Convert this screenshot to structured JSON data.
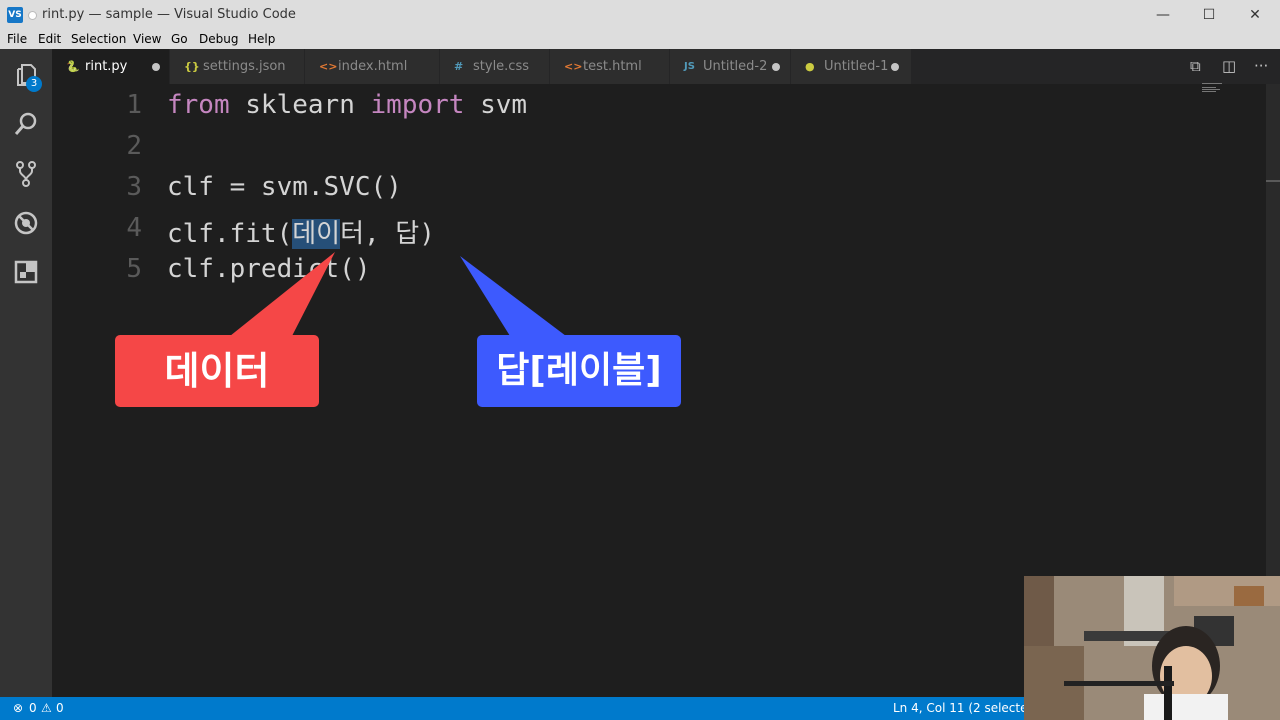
{
  "window": {
    "title": "rint.py — sample — Visual Studio Code",
    "logo": "VS",
    "controls": {
      "minimize": "—",
      "maximize": "☐",
      "close": "✕"
    }
  },
  "menu": [
    "File",
    "Edit",
    "Selection",
    "View",
    "Go",
    "Debug",
    "Help"
  ],
  "activity_bar": {
    "icons": [
      "files-icon",
      "search-icon",
      "source-control-icon",
      "debug-icon",
      "extensions-icon"
    ],
    "explorer_badge": "3"
  },
  "tabs": [
    {
      "label": "rint.py",
      "icon": "py",
      "dirty": true,
      "active": true
    },
    {
      "label": "settings.json",
      "icon": "{}",
      "dirty": false,
      "active": false
    },
    {
      "label": "index.html",
      "icon": "<>",
      "dirty": false,
      "active": false
    },
    {
      "label": "style.css",
      "icon": "#",
      "dirty": false,
      "active": false
    },
    {
      "label": "test.html",
      "icon": "<>",
      "dirty": false,
      "active": false
    },
    {
      "label": "Untitled-2",
      "icon": "JS",
      "dirty": true,
      "active": false
    },
    {
      "label": "Untitled-1",
      "icon": "py",
      "dirty": true,
      "active": false
    }
  ],
  "editor": {
    "line_numbers": [
      "1",
      "2",
      "3",
      "4",
      "5"
    ],
    "lines": [
      {
        "kw1": "from",
        "mid": " sklearn ",
        "kw2": "import",
        "end": " svm"
      },
      {
        "text": ""
      },
      {
        "text": "clf = svm.SVC()"
      },
      {
        "pre": "clf.fit(",
        "selected": "데이",
        "post": "터, 답)"
      },
      {
        "text": "clf.predict()"
      }
    ]
  },
  "annotations": {
    "data_label": "데이터",
    "label_label": "답[레이블]",
    "data_color": "#f54747",
    "label_color": "#3d5afe"
  },
  "status": {
    "errors": "0",
    "warnings": "0",
    "position": "Ln 4, Col 11 (2 selected)"
  }
}
